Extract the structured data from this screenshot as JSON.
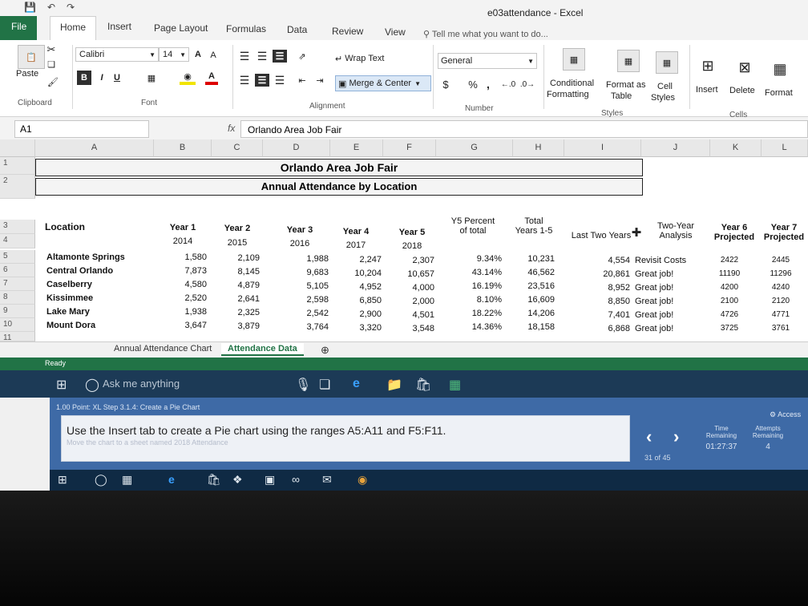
{
  "window": {
    "title": "e03attendance - Excel"
  },
  "tabs": [
    "File",
    "Home",
    "Insert",
    "Page Layout",
    "Formulas",
    "Data",
    "Review",
    "View"
  ],
  "tell_me": "Tell me what you want to do...",
  "ribbon": {
    "clipboard": {
      "paste": "Paste",
      "label": "Clipboard"
    },
    "font": {
      "name": "Calibri",
      "size": "14",
      "bold": "B",
      "italic": "I",
      "underline": "U",
      "grow": "A",
      "shrink": "A",
      "label": "Font"
    },
    "alignment": {
      "wrap": "Wrap Text",
      "merge": "Merge & Center",
      "label": "Alignment"
    },
    "number": {
      "format": "General",
      "currency": "$",
      "percent": "%",
      "comma": ",",
      "label": "Number"
    },
    "styles": {
      "conditional": [
        "Conditional",
        "Formatting"
      ],
      "format_table": [
        "Format as",
        "Table"
      ],
      "cell_styles": [
        "Cell",
        "Styles"
      ],
      "label": "Styles"
    },
    "cells": {
      "insert": "Insert",
      "delete": "Delete",
      "format": "Format",
      "label": "Cells"
    }
  },
  "formula_bar": {
    "name_box": "A1",
    "fx": "fx",
    "content": "Orlando Area Job Fair"
  },
  "columns": [
    "A",
    "B",
    "C",
    "D",
    "E",
    "F",
    "G",
    "H",
    "I",
    "J",
    "K",
    "L"
  ],
  "rows": [
    "1",
    "2",
    "3",
    "4",
    "5",
    "6",
    "7",
    "8",
    "9",
    "10",
    "11"
  ],
  "sheet": {
    "title": "Orlando Area Job Fair",
    "subtitle": "Annual Attendance by Location",
    "headers": {
      "location": "Location",
      "year1": "Year 1",
      "year2": "Year 2",
      "year3": "Year 3",
      "year4": "Year 4",
      "year5": "Year 5",
      "y5pct": [
        "Y5 Percent",
        "of total"
      ],
      "total": [
        "Total",
        "Years 1-5"
      ],
      "last_two": "Last Two Years",
      "two_year": [
        "Two-Year",
        "Analysis"
      ],
      "year6": [
        "Year 6",
        "Projected"
      ],
      "year7": [
        "Year 7",
        "Projected"
      ]
    },
    "year_values": [
      "2014",
      "2015",
      "2016",
      "2017",
      "2018"
    ],
    "data": [
      {
        "loc": "Altamonte Springs",
        "v": [
          "1,580",
          "2,109",
          "1,988",
          "2,247",
          "2,307"
        ],
        "pct": "9.34%",
        "total": "10,231",
        "last": "4,554",
        "analysis": "Revisit Costs",
        "y6": "2422",
        "y7": "2445"
      },
      {
        "loc": "Central Orlando",
        "v": [
          "7,873",
          "8,145",
          "9,683",
          "10,204",
          "10,657"
        ],
        "pct": "43.14%",
        "total": "46,562",
        "last": "20,861",
        "analysis": "Great job!",
        "y6": "11190",
        "y7": "11296"
      },
      {
        "loc": "Caselberry",
        "v": [
          "4,580",
          "4,879",
          "5,105",
          "4,952",
          "4,000"
        ],
        "pct": "16.19%",
        "total": "23,516",
        "last": "8,952",
        "analysis": "Great job!",
        "y6": "4200",
        "y7": "4240"
      },
      {
        "loc": "Kissimmee",
        "v": [
          "2,520",
          "2,641",
          "2,598",
          "6,850",
          "2,000"
        ],
        "pct": "8.10%",
        "total": "16,609",
        "last": "8,850",
        "analysis": "Great job!",
        "y6": "2100",
        "y7": "2120"
      },
      {
        "loc": "Lake Mary",
        "v": [
          "1,938",
          "2,325",
          "2,542",
          "2,900",
          "4,501"
        ],
        "pct": "18.22%",
        "total": "14,206",
        "last": "7,401",
        "analysis": "Great job!",
        "y6": "4726",
        "y7": "4771"
      },
      {
        "loc": "Mount Dora",
        "v": [
          "3,647",
          "3,879",
          "3,764",
          "3,320",
          "3,548"
        ],
        "pct": "14.36%",
        "total": "18,158",
        "last": "6,868",
        "analysis": "Great job!",
        "y6": "3725",
        "y7": "3761"
      }
    ]
  },
  "sheet_tabs": [
    "Annual Attendance Chart",
    "Attendance Data"
  ],
  "status": "Ready",
  "search": "Ask me anything",
  "task": {
    "header": "1.00 Point: XL Step 3.1.4: Create a Pie Chart",
    "instruction": "Use the Insert tab to create a Pie chart using the ranges A5:A11 and F5:F11.",
    "sub": "Move the chart to a sheet named 2018 Attendance",
    "progress": "31 of 45",
    "time_label": [
      "Time",
      "Remaining"
    ],
    "time_value": "01:27:37",
    "attempts_label": [
      "Attempts",
      "Remaining"
    ],
    "attempts_value": "4",
    "access": "Access"
  },
  "colors": {
    "excel_green": "#217346",
    "panel_blue": "#3e6aa6"
  }
}
